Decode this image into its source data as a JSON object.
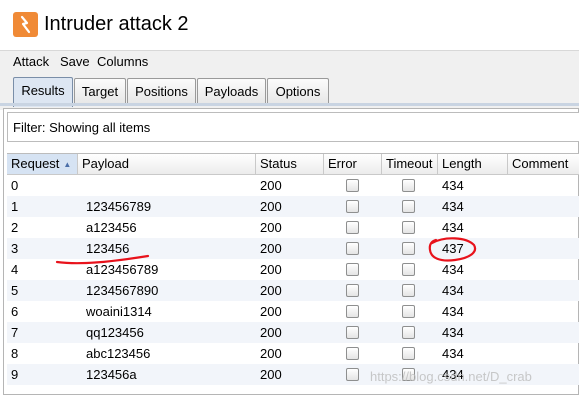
{
  "window": {
    "title": "Intruder attack 2",
    "icon": "burp-intruder-icon",
    "icon_color": "#f08a36"
  },
  "menu": [
    "Attack",
    "Save",
    "Columns"
  ],
  "tabs": [
    {
      "label": "Results",
      "active": true
    },
    {
      "label": "Target",
      "active": false
    },
    {
      "label": "Positions",
      "active": false
    },
    {
      "label": "Payloads",
      "active": false
    },
    {
      "label": "Options",
      "active": false
    }
  ],
  "filter": {
    "text": "Filter: Showing all items"
  },
  "table": {
    "columns": [
      "Request",
      "Payload",
      "Status",
      "Error",
      "Timeout",
      "Length",
      "Comment"
    ],
    "sorted_column": "Request",
    "sort_direction": "ascending",
    "rows": [
      {
        "request": "0",
        "payload": "",
        "status": "200",
        "error": false,
        "timeout": false,
        "length": "434",
        "comment": ""
      },
      {
        "request": "1",
        "payload": "123456789",
        "status": "200",
        "error": false,
        "timeout": false,
        "length": "434",
        "comment": ""
      },
      {
        "request": "2",
        "payload": "a123456",
        "status": "200",
        "error": false,
        "timeout": false,
        "length": "434",
        "comment": ""
      },
      {
        "request": "3",
        "payload": "123456",
        "status": "200",
        "error": false,
        "timeout": false,
        "length": "437",
        "comment": ""
      },
      {
        "request": "4",
        "payload": "a123456789",
        "status": "200",
        "error": false,
        "timeout": false,
        "length": "434",
        "comment": ""
      },
      {
        "request": "5",
        "payload": "1234567890",
        "status": "200",
        "error": false,
        "timeout": false,
        "length": "434",
        "comment": ""
      },
      {
        "request": "6",
        "payload": "woaini1314",
        "status": "200",
        "error": false,
        "timeout": false,
        "length": "434",
        "comment": ""
      },
      {
        "request": "7",
        "payload": "qq123456",
        "status": "200",
        "error": false,
        "timeout": false,
        "length": "434",
        "comment": ""
      },
      {
        "request": "8",
        "payload": "abc123456",
        "status": "200",
        "error": false,
        "timeout": false,
        "length": "434",
        "comment": ""
      },
      {
        "request": "9",
        "payload": "123456a",
        "status": "200",
        "error": false,
        "timeout": false,
        "length": "434",
        "comment": ""
      }
    ]
  },
  "annotation_color": "#e8121b",
  "watermark": "https://blog.csdn.net/D_crab"
}
